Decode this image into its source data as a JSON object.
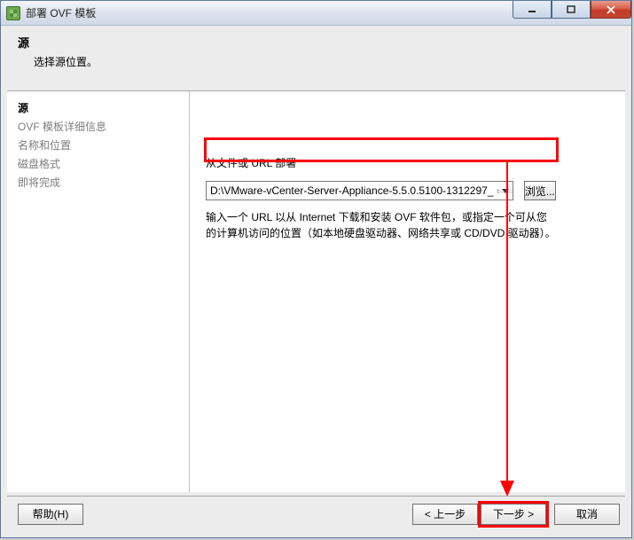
{
  "window": {
    "title": "部署 OVF 模板"
  },
  "header": {
    "title": "源",
    "subtitle": "选择源位置。"
  },
  "sidebar": {
    "items": [
      {
        "label": "源",
        "active": true
      },
      {
        "label": "OVF 模板详细信息",
        "active": false
      },
      {
        "label": "名称和位置",
        "active": false
      },
      {
        "label": "磁盘格式",
        "active": false
      },
      {
        "label": "即将完成",
        "active": false
      }
    ]
  },
  "content": {
    "field_label": "从文件或 URL 部署",
    "path_value": "D:\\VMware-vCenter-Server-Appliance-5.5.0.5100-1312297_",
    "browse_label": "浏览...",
    "hint": "输入一个 URL 以从 Internet 下载和安装 OVF 软件包，或指定一个可从您的计算机访问的位置（如本地硬盘驱动器、网络共享或 CD/DVD 驱动器）。"
  },
  "footer": {
    "help": "帮助(H)",
    "back": "< 上一步",
    "next": "下一步 >",
    "cancel": "取消"
  },
  "colors": {
    "highlight": "#ff0000"
  }
}
